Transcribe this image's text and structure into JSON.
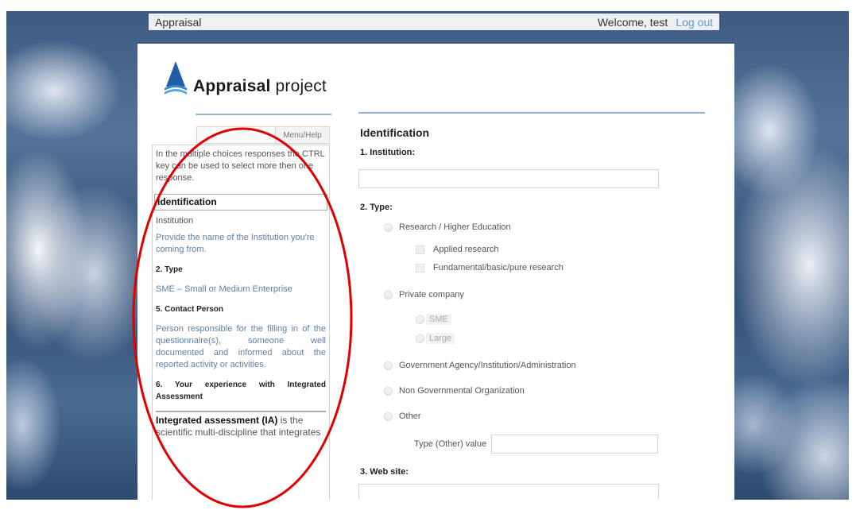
{
  "header": {
    "app_title": "Appraisal",
    "welcome": "Welcome, test",
    "logout": "Log out"
  },
  "logo": {
    "bold": "Appraisal",
    "rest": " project"
  },
  "sidebar": {
    "help_button": "Menu/Help",
    "intro": "In the multiple choices responses the CTRL key can be used to select more then one response.",
    "section_identification": "Identification",
    "institution_label": "Institution",
    "institution_help": "Provide the name of the Institution you're coming from.",
    "type_heading": "2. Type",
    "sme_help": "SME – Small or Medium Enterprise",
    "contact_heading": "5. Contact Person",
    "contact_help": "Person responsible for the filling in of the questionnaire(s), someone well documented and informed about the reported activity or activities.",
    "experience_heading": "6. Your experience with Integrated Assessment",
    "ia_term": "Integrated assessment (IA)",
    "ia_text": " is the scientific multi-discipline that integrates"
  },
  "form": {
    "title": "Identification",
    "q1": "1. Institution:",
    "q2": "2. Type:",
    "opt_research": "Research / Higher Education",
    "opt_applied": "Applied research",
    "opt_fundamental": "Fundamental/basic/pure research",
    "opt_private": "Private company",
    "opt_sme": "SME",
    "opt_large": "Large",
    "opt_gov": "Government Agency/Institution/Administration",
    "opt_ngo": "Non Governmental Organization",
    "opt_other": "Other",
    "other_label": "Type (Other) value",
    "q3": "3. Web site:"
  },
  "colors": {
    "accent_blue": "#5b9bd5",
    "rule_blue": "#8db3d6",
    "annotation_red": "#e00000"
  },
  "icons": {
    "logo": "appraisal-triangle-logo"
  }
}
